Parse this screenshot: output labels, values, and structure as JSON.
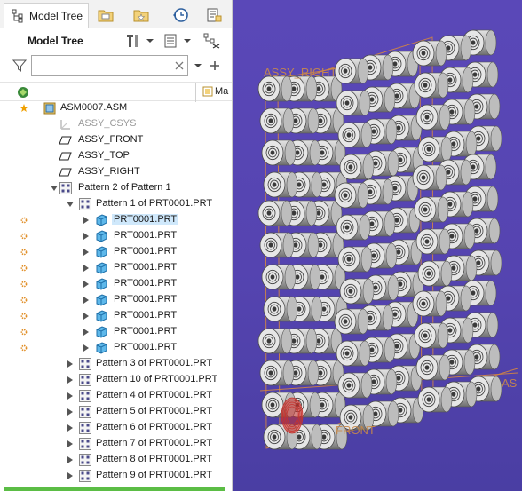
{
  "tabs": [
    {
      "label": "Model Tree",
      "active": true,
      "icon": "model-tree-icon"
    },
    {
      "icon": "layers-folder-icon"
    },
    {
      "icon": "favorites-folder-icon"
    },
    {
      "icon": "history-clock-icon"
    },
    {
      "icon": "properties-icon"
    }
  ],
  "header": {
    "title": "Model Tree",
    "tools_icon": "tools-icon",
    "settings_icon": "list-settings-icon",
    "extra_icon": "tree-display-icon"
  },
  "filter": {
    "value": "",
    "placeholder": ""
  },
  "column": {
    "label": "Ma"
  },
  "tree": [
    {
      "label": "ASM0007.ASM",
      "indent": 0,
      "type": "assembly",
      "expander": "none",
      "mark": "star"
    },
    {
      "label": "ASSY_CSYS",
      "indent": 1,
      "type": "csys",
      "expander": "none",
      "muted": true
    },
    {
      "label": "ASSY_FRONT",
      "indent": 1,
      "type": "plane",
      "expander": "none"
    },
    {
      "label": "ASSY_TOP",
      "indent": 1,
      "type": "plane",
      "expander": "none"
    },
    {
      "label": "ASSY_RIGHT",
      "indent": 1,
      "type": "plane",
      "expander": "none"
    },
    {
      "label": "Pattern 2 of Pattern 1",
      "indent": 1,
      "type": "pattern",
      "expander": "expanded"
    },
    {
      "label": "Pattern 1 of PRT0001.PRT",
      "indent": 2,
      "type": "pattern",
      "expander": "expanded"
    },
    {
      "label": "PRT0001.PRT",
      "indent": 3,
      "type": "part",
      "expander": "collapsed",
      "mark": "gear",
      "selected": true
    },
    {
      "label": "PRT0001.PRT",
      "indent": 3,
      "type": "part",
      "expander": "collapsed",
      "mark": "gear"
    },
    {
      "label": "PRT0001.PRT",
      "indent": 3,
      "type": "part",
      "expander": "collapsed",
      "mark": "gear"
    },
    {
      "label": "PRT0001.PRT",
      "indent": 3,
      "type": "part",
      "expander": "collapsed",
      "mark": "gear"
    },
    {
      "label": "PRT0001.PRT",
      "indent": 3,
      "type": "part",
      "expander": "collapsed",
      "mark": "gear"
    },
    {
      "label": "PRT0001.PRT",
      "indent": 3,
      "type": "part",
      "expander": "collapsed",
      "mark": "gear"
    },
    {
      "label": "PRT0001.PRT",
      "indent": 3,
      "type": "part",
      "expander": "collapsed",
      "mark": "gear"
    },
    {
      "label": "PRT0001.PRT",
      "indent": 3,
      "type": "part",
      "expander": "collapsed",
      "mark": "gear"
    },
    {
      "label": "PRT0001.PRT",
      "indent": 3,
      "type": "part",
      "expander": "collapsed",
      "mark": "gear"
    },
    {
      "label": "Pattern 3 of PRT0001.PRT",
      "indent": 2,
      "type": "pattern",
      "expander": "collapsed"
    },
    {
      "label": "Pattern 10 of PRT0001.PRT",
      "indent": 2,
      "type": "pattern",
      "expander": "collapsed"
    },
    {
      "label": "Pattern 4 of PRT0001.PRT",
      "indent": 2,
      "type": "pattern",
      "expander": "collapsed"
    },
    {
      "label": "Pattern 5 of PRT0001.PRT",
      "indent": 2,
      "type": "pattern",
      "expander": "collapsed"
    },
    {
      "label": "Pattern 6 of PRT0001.PRT",
      "indent": 2,
      "type": "pattern",
      "expander": "collapsed"
    },
    {
      "label": "Pattern 7 of PRT0001.PRT",
      "indent": 2,
      "type": "pattern",
      "expander": "collapsed"
    },
    {
      "label": "Pattern 8 of PRT0001.PRT",
      "indent": 2,
      "type": "pattern",
      "expander": "collapsed"
    },
    {
      "label": "Pattern 9 of PRT0001.PRT",
      "indent": 2,
      "type": "pattern",
      "expander": "collapsed"
    }
  ],
  "viewport": {
    "labels": [
      "ASSY_RIGHT",
      "AS",
      "FRONT"
    ],
    "colors": {
      "background": "#5645b0",
      "datum": "#d98a3c",
      "cylinder_light": "#d4d4d4",
      "cylinder_dark": "#6e6e6e",
      "highlight": "#c8322c"
    }
  },
  "colors": {
    "selection": "#cfe8fb",
    "accent_green": "#5bbd45",
    "gear_mark": "#e08a1e",
    "star_mark": "#f0a000"
  }
}
